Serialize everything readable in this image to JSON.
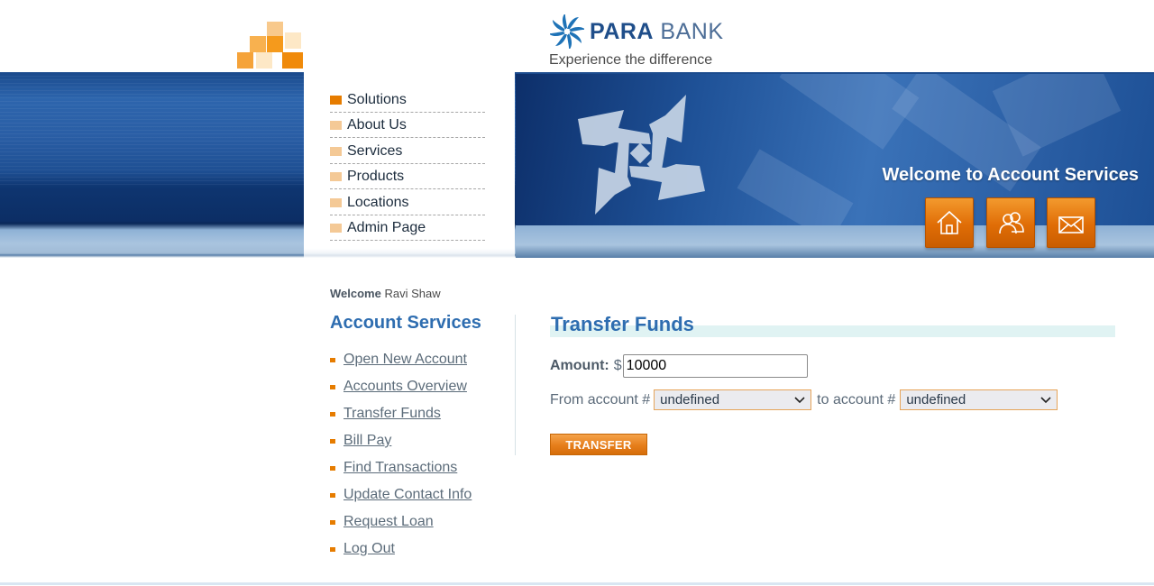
{
  "brand": {
    "logo_text_bold": "PARA",
    "logo_text": " BANK",
    "tagline": "Experience the difference",
    "colors": {
      "primary_blue": "#1f4e8a",
      "accent_orange": "#e67c00",
      "heading_blue": "#2e6db0"
    }
  },
  "top_menu": [
    {
      "label": "Solutions",
      "active": true
    },
    {
      "label": "About Us"
    },
    {
      "label": "Services"
    },
    {
      "label": "Products"
    },
    {
      "label": "Locations"
    },
    {
      "label": "Admin Page"
    }
  ],
  "header": {
    "welcome_banner": "Welcome to Account Services",
    "icons": [
      "home-icon",
      "contacts-icon",
      "mail-icon"
    ]
  },
  "sidebar": {
    "welcome_label": "Welcome",
    "user_name": "Ravi Shaw",
    "title": "Account Services",
    "links": [
      "Open New Account",
      "Accounts Overview",
      "Transfer Funds",
      "Bill Pay",
      "Find Transactions",
      "Update Contact Info",
      "Request Loan",
      "Log Out"
    ]
  },
  "main": {
    "title": "Transfer Funds",
    "amount_label": "Amount:",
    "currency": "$",
    "amount_value": "10000",
    "from_label": "From account #",
    "from_value": "undefined",
    "to_label": "to account #",
    "to_value": "undefined",
    "submit_label": "TRANSFER"
  }
}
